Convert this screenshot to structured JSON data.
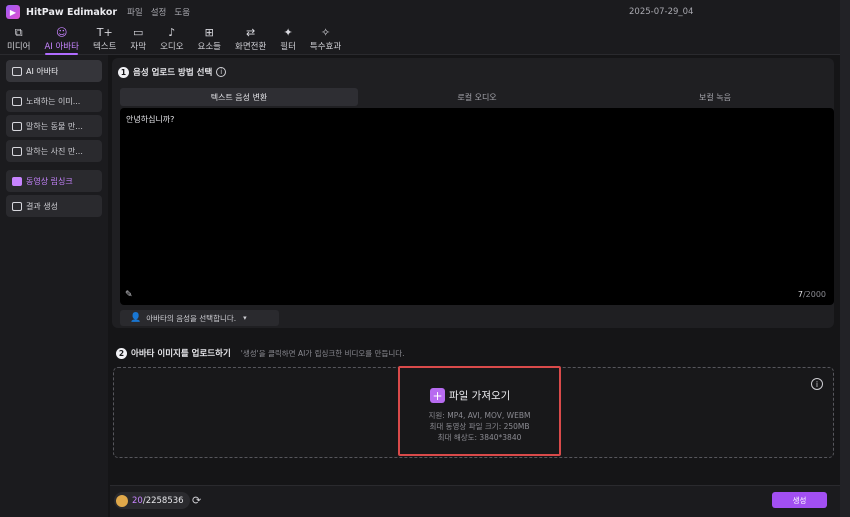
{
  "app": {
    "title": "HitPaw Edimakor",
    "logo_glyph": "▶",
    "menu": [
      "파일",
      "설정",
      "도움"
    ],
    "project_name": "2025-07-29_04"
  },
  "toolbar": {
    "items": [
      {
        "label": "미디어",
        "icon": "media-icon",
        "glyph": "⧉"
      },
      {
        "label": "AI 아바타",
        "icon": "ai-avatar-icon",
        "glyph": "☺"
      },
      {
        "label": "텍스트",
        "icon": "text-icon",
        "glyph": "T+"
      },
      {
        "label": "자막",
        "icon": "subtitle-icon",
        "glyph": "▭"
      },
      {
        "label": "오디오",
        "icon": "audio-icon",
        "glyph": "♪"
      },
      {
        "label": "요소들",
        "icon": "elements-icon",
        "glyph": "⊞"
      },
      {
        "label": "화면전환",
        "icon": "transition-icon",
        "glyph": "⇄"
      },
      {
        "label": "필터",
        "icon": "filter-icon",
        "glyph": "✦"
      },
      {
        "label": "특수효과",
        "icon": "effects-icon",
        "glyph": "✧"
      }
    ],
    "active_index": 1
  },
  "sidebar": {
    "items": [
      {
        "label": "AI 아바타"
      },
      {
        "label": "노래하는 이미..."
      },
      {
        "label": "말하는 동물 만..."
      },
      {
        "label": "말하는 사진 만..."
      },
      {
        "label": "동영상 립싱크"
      },
      {
        "label": "결과 생성"
      }
    ],
    "active_index": 4
  },
  "step1": {
    "number": "1",
    "title": "음성 업로드 방법 선택",
    "tabs": [
      "텍스트 음성 변환",
      "로컬 오디오",
      "보컬 녹음"
    ],
    "active_tab": 0,
    "text_value": "안녕하십니까?",
    "count_current": "7",
    "count_max": "/2000",
    "voice_select_label": "아바타의 음성을 선택합니다."
  },
  "step2": {
    "number": "2",
    "title": "아바타 이미지를 업로드하기",
    "hint": "'생성'을 클릭하면 AI가 립싱크한 비디오를 만듭니다.",
    "import_label": "파일 가져오기",
    "support": "지원: MP4, AVI, MOV, WEBM",
    "max_size": "최대 동영상 파일 크기: 250MB",
    "max_res": "최대 해상도: 3840*3840"
  },
  "footer": {
    "credits_used": "20",
    "credits_total": "/2258536",
    "generate_label": "생성"
  },
  "colors": {
    "accent": "#b06cff",
    "generate_button": "#a24ff2",
    "highlight_border": "#d94a4a",
    "coin": "#e0a84a"
  }
}
